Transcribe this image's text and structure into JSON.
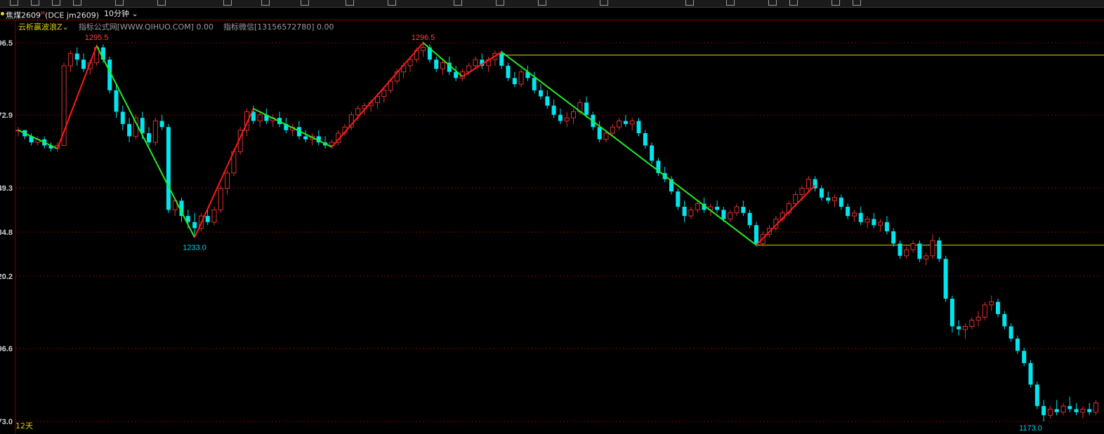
{
  "symbol": {
    "name": "焦煤2609",
    "superscript": "M",
    "exchange_code": "(DCE  jm2609)",
    "period": "10分钟"
  },
  "indicator": {
    "name": "云析赢波浪Z",
    "formula_label": "指标公式网[WWW.QIHUO.COM] 0.00",
    "wechat_label": "指标微信[13156572780] 0.00"
  },
  "period_footer": "12天",
  "colors": {
    "background": "#000000",
    "up": "#e03030",
    "down": "#00e5ee",
    "wave_up": "#ff1a1a",
    "wave_down": "#22ee22",
    "support_line": "#d4d400",
    "grid": "#8a0000",
    "high_label": "#ff4040",
    "low_label": "#00d0e0"
  },
  "chart_data": {
    "type": "candlestick",
    "y_tick_labels": [
      "96.5",
      "72.9",
      "49.3",
      "34.8",
      "20.2",
      "96.6",
      "73.0"
    ],
    "y_tick_values": [
      1296.5,
      1272.9,
      1249.3,
      1234.8,
      1220.2,
      1196.6,
      1173.0
    ],
    "ylim": [
      1173.0,
      1296.5
    ],
    "grid": true,
    "annotations": [
      {
        "text": "1295.5",
        "bar": 12,
        "kind": "high"
      },
      {
        "text": "1233.0",
        "bar": 27,
        "kind": "low"
      },
      {
        "text": "1296.5",
        "bar": 62,
        "kind": "high"
      },
      {
        "text": "1173.0",
        "bar": 155,
        "kind": "low"
      }
    ],
    "wave_points": [
      {
        "bar": 0,
        "price": 1268.0
      },
      {
        "bar": 6,
        "price": 1262.0
      },
      {
        "bar": 12,
        "price": 1295.5
      },
      {
        "bar": 27,
        "price": 1233.0
      },
      {
        "bar": 36,
        "price": 1275.0
      },
      {
        "bar": 48,
        "price": 1262.5
      },
      {
        "bar": 62,
        "price": 1296.5
      },
      {
        "bar": 68,
        "price": 1285.5
      },
      {
        "bar": 74,
        "price": 1293.5
      },
      {
        "bar": 113,
        "price": 1230.5
      },
      {
        "bar": 122,
        "price": 1250.0
      }
    ],
    "support_lines": [
      {
        "from_bar": 74,
        "price": 1292.5
      },
      {
        "from_bar": 113,
        "price": 1230.5
      }
    ],
    "candles": [
      [
        1268,
        1269,
        1266,
        1268
      ],
      [
        1268,
        1268,
        1265,
        1266
      ],
      [
        1266,
        1267,
        1263,
        1264
      ],
      [
        1264,
        1266,
        1263,
        1265
      ],
      [
        1265,
        1266,
        1262,
        1263
      ],
      [
        1263,
        1264,
        1261,
        1262
      ],
      [
        1262,
        1264,
        1261,
        1263
      ],
      [
        1263,
        1290,
        1263,
        1289
      ],
      [
        1289,
        1294,
        1287,
        1293
      ],
      [
        1293,
        1295,
        1289,
        1291
      ],
      [
        1291,
        1293,
        1287,
        1288
      ],
      [
        1288,
        1291,
        1286,
        1290
      ],
      [
        1290,
        1296,
        1289,
        1295
      ],
      [
        1295,
        1296,
        1290,
        1291
      ],
      [
        1291,
        1292,
        1280,
        1281
      ],
      [
        1281,
        1283,
        1272,
        1274
      ],
      [
        1274,
        1276,
        1268,
        1270
      ],
      [
        1270,
        1272,
        1264,
        1266
      ],
      [
        1266,
        1273,
        1265,
        1272
      ],
      [
        1272,
        1274,
        1265,
        1267
      ],
      [
        1267,
        1269,
        1263,
        1264
      ],
      [
        1264,
        1272,
        1263,
        1271
      ],
      [
        1271,
        1273,
        1268,
        1269
      ],
      [
        1269,
        1270,
        1241,
        1242
      ],
      [
        1242,
        1246,
        1240,
        1245
      ],
      [
        1245,
        1246,
        1238,
        1240
      ],
      [
        1240,
        1242,
        1236,
        1238
      ],
      [
        1238,
        1241,
        1233,
        1236
      ],
      [
        1236,
        1241,
        1235,
        1240
      ],
      [
        1240,
        1242,
        1237,
        1238
      ],
      [
        1238,
        1243,
        1237,
        1242
      ],
      [
        1242,
        1250,
        1241,
        1249
      ],
      [
        1249,
        1255,
        1247,
        1254
      ],
      [
        1254,
        1262,
        1253,
        1261
      ],
      [
        1261,
        1269,
        1260,
        1268
      ],
      [
        1268,
        1275,
        1266,
        1274
      ],
      [
        1274,
        1276,
        1270,
        1271
      ],
      [
        1271,
        1274,
        1269,
        1273
      ],
      [
        1273,
        1275,
        1270,
        1271
      ],
      [
        1271,
        1273,
        1269,
        1272
      ],
      [
        1272,
        1274,
        1269,
        1270
      ],
      [
        1270,
        1272,
        1267,
        1268
      ],
      [
        1268,
        1270,
        1266,
        1269
      ],
      [
        1269,
        1271,
        1265,
        1266
      ],
      [
        1266,
        1268,
        1264,
        1265
      ],
      [
        1265,
        1267,
        1263,
        1266
      ],
      [
        1266,
        1268,
        1263,
        1264
      ],
      [
        1264,
        1266,
        1262,
        1263
      ],
      [
        1263,
        1265,
        1262,
        1264
      ],
      [
        1264,
        1268,
        1263,
        1267
      ],
      [
        1267,
        1270,
        1266,
        1269
      ],
      [
        1269,
        1274,
        1268,
        1273
      ],
      [
        1273,
        1276,
        1271,
        1275
      ],
      [
        1275,
        1277,
        1273,
        1276
      ],
      [
        1276,
        1278,
        1274,
        1277
      ],
      [
        1277,
        1280,
        1275,
        1279
      ],
      [
        1279,
        1282,
        1277,
        1281
      ],
      [
        1281,
        1285,
        1280,
        1284
      ],
      [
        1284,
        1288,
        1283,
        1287
      ],
      [
        1287,
        1290,
        1285,
        1289
      ],
      [
        1289,
        1292,
        1287,
        1291
      ],
      [
        1291,
        1295,
        1290,
        1294
      ],
      [
        1294,
        1297,
        1292,
        1295
      ],
      [
        1295,
        1296,
        1290,
        1291
      ],
      [
        1291,
        1292,
        1287,
        1288
      ],
      [
        1288,
        1291,
        1286,
        1290
      ],
      [
        1290,
        1292,
        1286,
        1287
      ],
      [
        1287,
        1289,
        1284,
        1285
      ],
      [
        1285,
        1288,
        1284,
        1287
      ],
      [
        1287,
        1290,
        1286,
        1289
      ],
      [
        1289,
        1292,
        1288,
        1291
      ],
      [
        1291,
        1293,
        1288,
        1289
      ],
      [
        1289,
        1292,
        1287,
        1291
      ],
      [
        1291,
        1294,
        1289,
        1293
      ],
      [
        1293,
        1294,
        1288,
        1289
      ],
      [
        1289,
        1290,
        1284,
        1285
      ],
      [
        1285,
        1287,
        1282,
        1283
      ],
      [
        1283,
        1288,
        1282,
        1287
      ],
      [
        1287,
        1289,
        1284,
        1285
      ],
      [
        1285,
        1287,
        1280,
        1281
      ],
      [
        1281,
        1283,
        1278,
        1279
      ],
      [
        1279,
        1281,
        1275,
        1276
      ],
      [
        1276,
        1278,
        1272,
        1273
      ],
      [
        1273,
        1275,
        1270,
        1271
      ],
      [
        1271,
        1274,
        1269,
        1272
      ],
      [
        1272,
        1275,
        1270,
        1274
      ],
      [
        1274,
        1278,
        1273,
        1277
      ],
      [
        1277,
        1279,
        1272,
        1273
      ],
      [
        1273,
        1274,
        1268,
        1269
      ],
      [
        1269,
        1271,
        1264,
        1265
      ],
      [
        1265,
        1268,
        1264,
        1267
      ],
      [
        1267,
        1270,
        1266,
        1269
      ],
      [
        1269,
        1272,
        1268,
        1271
      ],
      [
        1271,
        1273,
        1269,
        1270
      ],
      [
        1270,
        1272,
        1268,
        1271
      ],
      [
        1271,
        1272,
        1266,
        1267
      ],
      [
        1267,
        1268,
        1262,
        1263
      ],
      [
        1263,
        1264,
        1257,
        1258
      ],
      [
        1258,
        1259,
        1253,
        1254
      ],
      [
        1254,
        1256,
        1251,
        1252
      ],
      [
        1252,
        1253,
        1247,
        1248
      ],
      [
        1248,
        1249,
        1242,
        1243
      ],
      [
        1243,
        1245,
        1238,
        1240
      ],
      [
        1240,
        1243,
        1239,
        1242
      ],
      [
        1242,
        1245,
        1241,
        1244
      ],
      [
        1244,
        1246,
        1241,
        1242
      ],
      [
        1242,
        1244,
        1240,
        1243
      ],
      [
        1243,
        1245,
        1241,
        1242
      ],
      [
        1242,
        1243,
        1238,
        1239
      ],
      [
        1239,
        1242,
        1238,
        1241
      ],
      [
        1241,
        1244,
        1240,
        1243
      ],
      [
        1243,
        1245,
        1240,
        1241
      ],
      [
        1241,
        1242,
        1236,
        1237
      ],
      [
        1237,
        1238,
        1230,
        1231
      ],
      [
        1231,
        1235,
        1230,
        1234
      ],
      [
        1234,
        1237,
        1233,
        1236
      ],
      [
        1236,
        1240,
        1235,
        1239
      ],
      [
        1239,
        1242,
        1238,
        1241
      ],
      [
        1241,
        1245,
        1240,
        1244
      ],
      [
        1244,
        1248,
        1243,
        1247
      ],
      [
        1247,
        1250,
        1245,
        1249
      ],
      [
        1249,
        1253,
        1248,
        1252
      ],
      [
        1252,
        1253,
        1248,
        1249
      ],
      [
        1249,
        1250,
        1245,
        1246
      ],
      [
        1246,
        1248,
        1244,
        1245
      ],
      [
        1245,
        1247,
        1243,
        1246
      ],
      [
        1246,
        1247,
        1242,
        1243
      ],
      [
        1243,
        1244,
        1239,
        1240
      ],
      [
        1240,
        1242,
        1238,
        1241
      ],
      [
        1241,
        1243,
        1237,
        1238
      ],
      [
        1238,
        1240,
        1236,
        1239
      ],
      [
        1239,
        1241,
        1236,
        1237
      ],
      [
        1237,
        1239,
        1235,
        1238
      ],
      [
        1238,
        1240,
        1234,
        1235
      ],
      [
        1235,
        1236,
        1230,
        1231
      ],
      [
        1231,
        1232,
        1226,
        1227
      ],
      [
        1227,
        1230,
        1226,
        1229
      ],
      [
        1229,
        1232,
        1228,
        1231
      ],
      [
        1231,
        1232,
        1225,
        1226
      ],
      [
        1226,
        1228,
        1224,
        1227
      ],
      [
        1227,
        1234,
        1226,
        1232
      ],
      [
        1232,
        1233,
        1225,
        1226
      ],
      [
        1226,
        1227,
        1212,
        1213
      ],
      [
        1213,
        1214,
        1202,
        1204
      ],
      [
        1204,
        1206,
        1201,
        1203
      ],
      [
        1203,
        1205,
        1200,
        1204
      ],
      [
        1204,
        1207,
        1203,
        1206
      ],
      [
        1206,
        1209,
        1204,
        1207
      ],
      [
        1207,
        1212,
        1206,
        1211
      ],
      [
        1211,
        1214,
        1209,
        1212
      ],
      [
        1212,
        1213,
        1207,
        1208
      ],
      [
        1208,
        1209,
        1203,
        1204
      ],
      [
        1204,
        1205,
        1199,
        1200
      ],
      [
        1200,
        1201,
        1195,
        1196
      ],
      [
        1196,
        1197,
        1191,
        1192
      ],
      [
        1192,
        1193,
        1184,
        1185
      ],
      [
        1185,
        1186,
        1177,
        1178
      ],
      [
        1178,
        1180,
        1173,
        1175
      ],
      [
        1175,
        1178,
        1174,
        1177
      ],
      [
        1177,
        1180,
        1175,
        1176
      ],
      [
        1176,
        1179,
        1175,
        1178
      ],
      [
        1178,
        1181,
        1176,
        1177
      ],
      [
        1177,
        1179,
        1175,
        1176
      ],
      [
        1176,
        1178,
        1174,
        1177
      ],
      [
        1177,
        1179,
        1175,
        1176
      ],
      [
        1176,
        1180,
        1175,
        1179
      ]
    ]
  }
}
